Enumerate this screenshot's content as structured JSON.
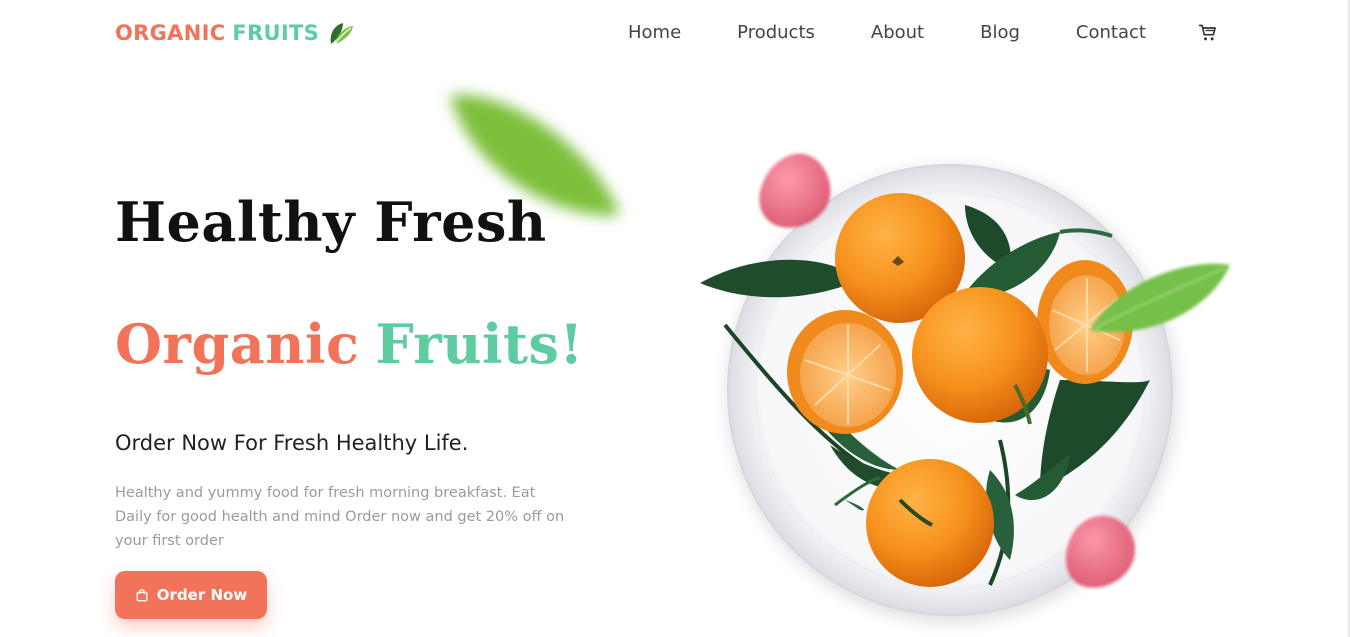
{
  "logo": {
    "part1": "ORGANIC",
    "part2": "FRUITS",
    "icon": "leaf-icon"
  },
  "nav": {
    "items": [
      {
        "label": "Home"
      },
      {
        "label": "Products"
      },
      {
        "label": "About"
      },
      {
        "label": "Blog"
      },
      {
        "label": "Contact"
      }
    ],
    "cart_icon": "cart-icon"
  },
  "hero": {
    "title_line1": "Healthy Fresh",
    "title_line2_part1": "Organic",
    "title_line2_part2": "Fruits!",
    "subtitle": "Order Now For Fresh Healthy Life.",
    "description": "Healthy and yummy food for fresh morning breakfast. Eat Daily for good health and mind Order now and get 20% off on your first order",
    "cta_label": "Order Now",
    "cta_icon": "shopping-bag-icon"
  },
  "colors": {
    "accent_coral": "#f0735a",
    "accent_mint": "#5ecba1",
    "text_dark": "#111111",
    "text_muted": "#9a9aa4"
  }
}
